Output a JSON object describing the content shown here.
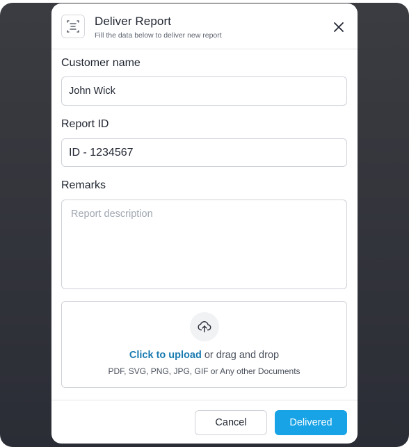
{
  "dialog": {
    "title": "Deliver Report",
    "subtitle": "Fill the data below to deliver new report",
    "header_icon": "report-icon",
    "close_icon": "close-icon"
  },
  "form": {
    "customer_label": "Customer name",
    "customer_value": "John Wick",
    "report_id_label": "Report ID",
    "report_id_value": "ID - 1234567",
    "remarks_label": "Remarks",
    "remarks_placeholder": "Report description"
  },
  "upload": {
    "icon": "upload-cloud-icon",
    "link_text": "Click to upload",
    "rest_text": " or drag and drop",
    "formats": "PDF, SVG, PNG, JPG, GIF or Any other Documents"
  },
  "footer": {
    "cancel_label": "Cancel",
    "submit_label": "Delivered"
  },
  "colors": {
    "accent": "#17a3e6",
    "link": "#1a7bb0",
    "backdrop": "#2f3038"
  }
}
